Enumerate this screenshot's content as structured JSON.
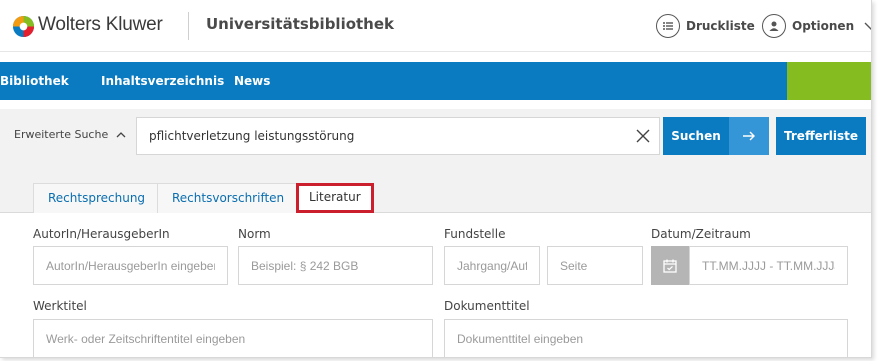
{
  "header": {
    "brand": "Wolters Kluwer",
    "library": "Universitätsbibliothek",
    "druckliste_label": "Druckliste",
    "optionen_label": "Optionen"
  },
  "nav": {
    "items": [
      "Bibliothek",
      "Inhaltsverzeichnis",
      "News"
    ]
  },
  "search": {
    "extended_label": "Erweiterte Suche",
    "query": "pflichtverletzung leistungsstörung",
    "search_button": "Suchen",
    "results_button": "Trefferliste"
  },
  "tabs": [
    "Rechtsprechung",
    "Rechtsvorschriften",
    "Literatur"
  ],
  "active_tab": "Literatur",
  "form": {
    "author_label": "AutorIn/HerausgeberIn",
    "author_placeholder": "AutorIn/HerausgeberIn eingeben",
    "norm_label": "Norm",
    "norm_placeholder": "Beispiel: § 242 BGB",
    "fundstelle_label": "Fundstelle",
    "jahrgang_placeholder": "Jahrgang/Auflage",
    "seite_placeholder": "Seite",
    "datum_label": "Datum/Zeitraum",
    "datum_placeholder": "TT.MM.JJJJ - TT.MM.JJJJ",
    "werktitel_label": "Werktitel",
    "werktitel_placeholder": "Werk- oder Zeitschriftentitel eingeben",
    "dokumenttitel_label": "Dokumenttitel",
    "dokumenttitel_placeholder": "Dokumenttitel eingeben"
  },
  "colors": {
    "primary_blue": "#0a7bc1",
    "accent_green": "#85bc20",
    "active_tab_border": "#cc1f2d"
  },
  "icons": [
    "wolters-kluwer-logo",
    "list-icon",
    "user-icon",
    "chevron-down-icon",
    "chevron-up-icon",
    "close-icon",
    "arrow-right-icon",
    "calendar-icon"
  ]
}
